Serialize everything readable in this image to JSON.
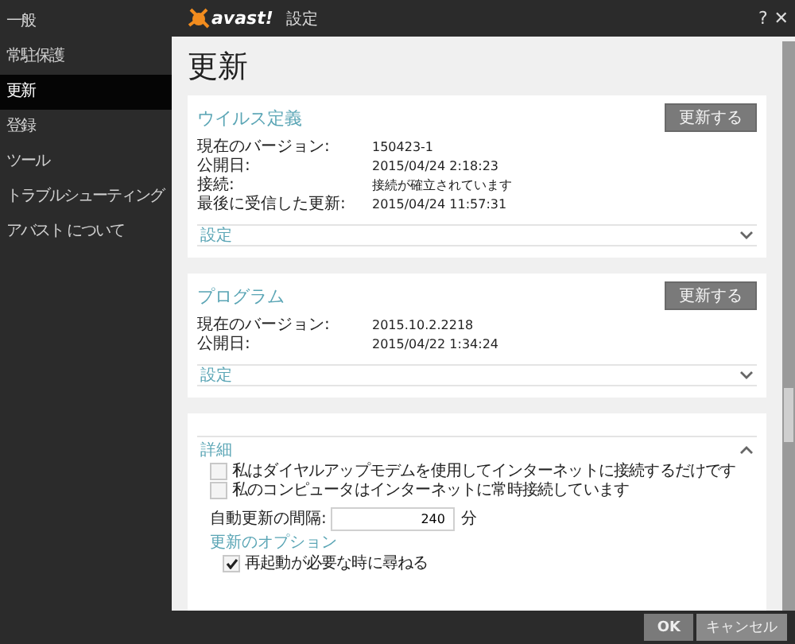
{
  "window": {
    "logo": "avast!",
    "title": "設定",
    "help": "?",
    "close": "✕"
  },
  "sidebar": {
    "items": [
      {
        "label": "一般",
        "selected": false
      },
      {
        "label": "常駐保護",
        "selected": false
      },
      {
        "label": "更新",
        "selected": true
      },
      {
        "label": "登録",
        "selected": false
      },
      {
        "label": "ツール",
        "selected": false
      },
      {
        "label": "トラブルシューティング",
        "selected": false
      },
      {
        "label": "アバスト について",
        "selected": false
      }
    ]
  },
  "page_title": "更新",
  "sections": [
    {
      "title": "ウイルス定義",
      "button": "更新する",
      "rows": [
        {
          "label": "現在のバージョン:",
          "value": "150423-1"
        },
        {
          "label": "公開日:",
          "value": "2015/04/24 2:18:23"
        },
        {
          "label": "接続:",
          "value": "接続が確立されています"
        },
        {
          "label": "最後に受信した更新:",
          "value": "2015/04/24 11:57:31"
        }
      ],
      "settings": {
        "label": "設定",
        "expanded": false
      }
    },
    {
      "title": "プログラム",
      "button": "更新する",
      "rows": [
        {
          "label": "現在のバージョン:",
          "value": "2015.10.2.2218"
        },
        {
          "label": "公開日:",
          "value": "2015/04/22 1:34:24"
        }
      ],
      "settings": {
        "label": "設定",
        "expanded": false
      }
    }
  ],
  "details": {
    "title": "詳細",
    "expanded": true,
    "options": [
      {
        "label": "私はダイヤルアップモデムを使用してインターネットに接続するだけです",
        "checked": false
      },
      {
        "label": "私のコンピュータはインターネットに常時接続しています",
        "checked": false
      }
    ],
    "interval": {
      "label": "自動更新の間隔:",
      "value": "240",
      "unit": "分"
    },
    "link": "更新のオプション",
    "more_options": [
      {
        "label": "再起動が必要な時に尋ねる",
        "checked": true
      }
    ]
  },
  "footer": {
    "buttons": [
      {
        "label": "OK",
        "kind": "primary"
      },
      {
        "label": "キャンセル",
        "kind": "secondary"
      }
    ]
  }
}
